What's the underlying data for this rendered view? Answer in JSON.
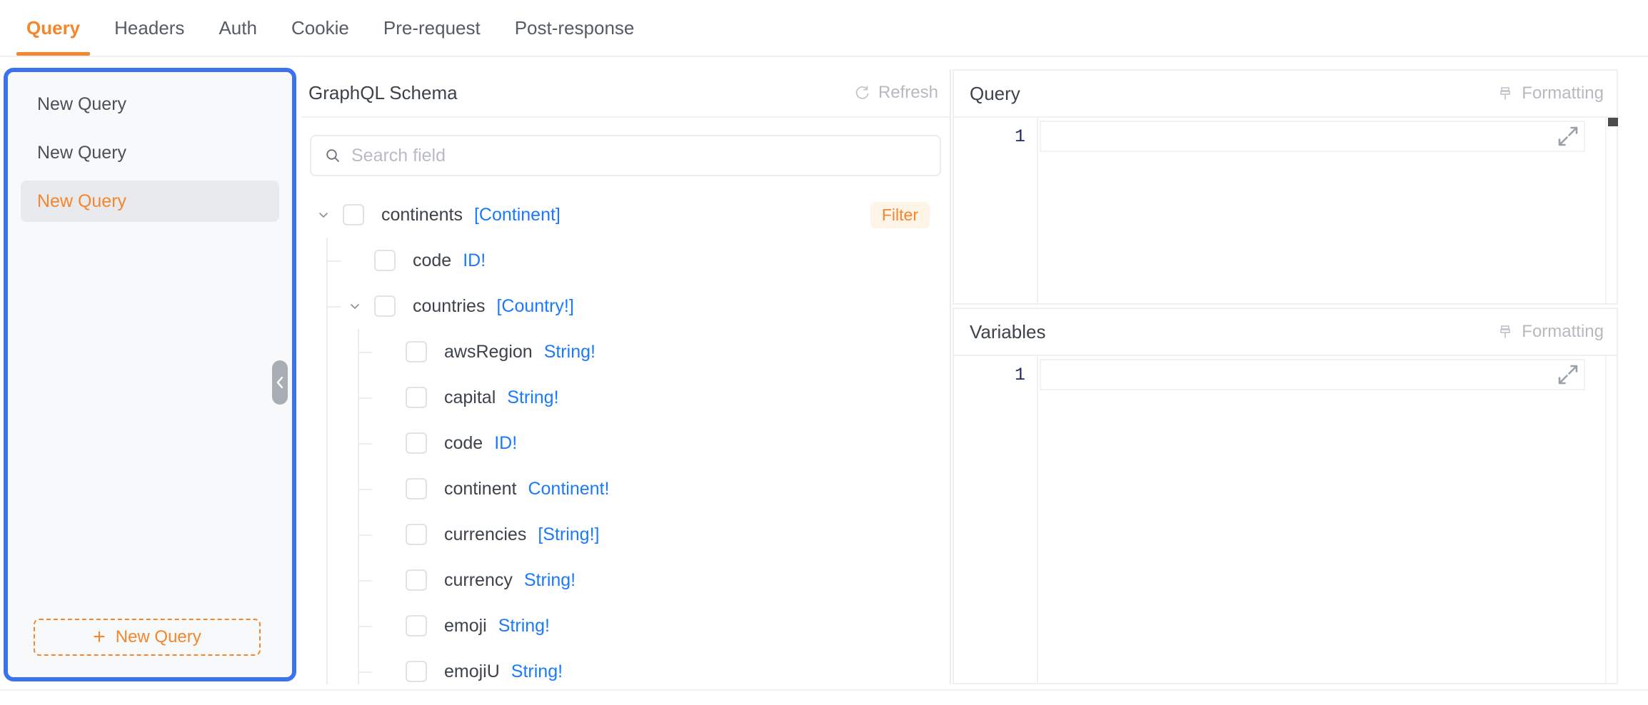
{
  "tabs": [
    {
      "label": "Query",
      "active": true
    },
    {
      "label": "Headers",
      "active": false
    },
    {
      "label": "Auth",
      "active": false
    },
    {
      "label": "Cookie",
      "active": false
    },
    {
      "label": "Pre-request",
      "active": false
    },
    {
      "label": "Post-response",
      "active": false
    }
  ],
  "sidebar": {
    "items": [
      {
        "label": "New Query",
        "selected": false
      },
      {
        "label": "New Query",
        "selected": false
      },
      {
        "label": "New Query",
        "selected": true
      }
    ],
    "new_query_button": {
      "label": "New Query",
      "plus": "+"
    },
    "collapse_handle_icon": "chevron-left-icon"
  },
  "schema_panel": {
    "title": "GraphQL Schema",
    "refresh_label": "Refresh",
    "search_placeholder": "Search field",
    "filter_badge": "Filter",
    "tree": [
      {
        "name": "continents",
        "type": "[Continent]",
        "depth": 0,
        "expanded": true,
        "has_chevron": true,
        "filter": true
      },
      {
        "name": "code",
        "type": "ID!",
        "depth": 1,
        "has_chevron": false,
        "filter": false
      },
      {
        "name": "countries",
        "type": "[Country!]",
        "depth": 1,
        "expanded": true,
        "has_chevron": true,
        "filter": false
      },
      {
        "name": "awsRegion",
        "type": "String!",
        "depth": 2,
        "has_chevron": false,
        "filter": false
      },
      {
        "name": "capital",
        "type": "String!",
        "depth": 2,
        "has_chevron": false,
        "filter": false
      },
      {
        "name": "code",
        "type": "ID!",
        "depth": 2,
        "has_chevron": false,
        "filter": false
      },
      {
        "name": "continent",
        "type": "Continent!",
        "depth": 2,
        "has_chevron": false,
        "filter": false
      },
      {
        "name": "currencies",
        "type": "[String!]",
        "depth": 2,
        "has_chevron": false,
        "filter": false
      },
      {
        "name": "currency",
        "type": "String!",
        "depth": 2,
        "has_chevron": false,
        "filter": false
      },
      {
        "name": "emoji",
        "type": "String!",
        "depth": 2,
        "has_chevron": false,
        "filter": false
      },
      {
        "name": "emojiU",
        "type": "String!",
        "depth": 2,
        "has_chevron": false,
        "filter": false
      }
    ]
  },
  "query_editor": {
    "title": "Query",
    "formatting_label": "Formatting",
    "line_number": "1",
    "content": ""
  },
  "variables_editor": {
    "title": "Variables",
    "formatting_label": "Formatting",
    "line_number": "1",
    "content": ""
  },
  "colors": {
    "accent_orange": "#f5862b",
    "focus_blue": "#3a72f0",
    "type_blue": "#1a7aff",
    "text_gray": "#3d434b",
    "muted_gray": "#b6bac0"
  }
}
